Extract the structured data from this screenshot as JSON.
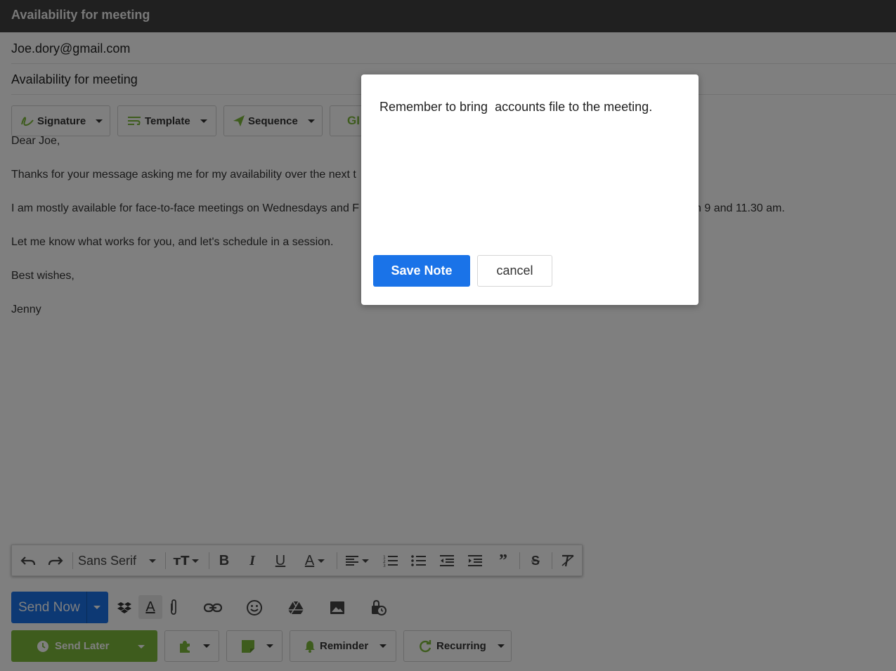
{
  "window": {
    "title": "Availability for meeting"
  },
  "compose": {
    "to": "Joe.dory@gmail.com",
    "subject": "Availability for meeting"
  },
  "toolbar": {
    "signature": "Signature",
    "template": "Template",
    "sequence": "Sequence",
    "gif_partial": "GI"
  },
  "body_lines": [
    "Dear Joe,",
    "Thanks for your message asking me for my availability over the next t",
    "I am mostly available for face-to-face meetings on Wednesdays and F",
    "Let me know what works for you, and let's schedule in a session.",
    "Best wishes,",
    "Jenny"
  ],
  "body_line_tail": "n 9 and 11.30 am.",
  "format_bar": {
    "font": "Sans Serif"
  },
  "send": {
    "send_now": "Send Now",
    "send_later": "Send Later"
  },
  "bottom_buttons": {
    "reminder": "Reminder",
    "recurring": "Recurring"
  },
  "modal": {
    "note_text": "Remember to bring  accounts file to the meeting.",
    "save_label": "Save Note",
    "cancel_label": "cancel"
  },
  "colors": {
    "primary": "#1a73e8",
    "green": "#7cb83a",
    "titlebar": "#404040"
  }
}
